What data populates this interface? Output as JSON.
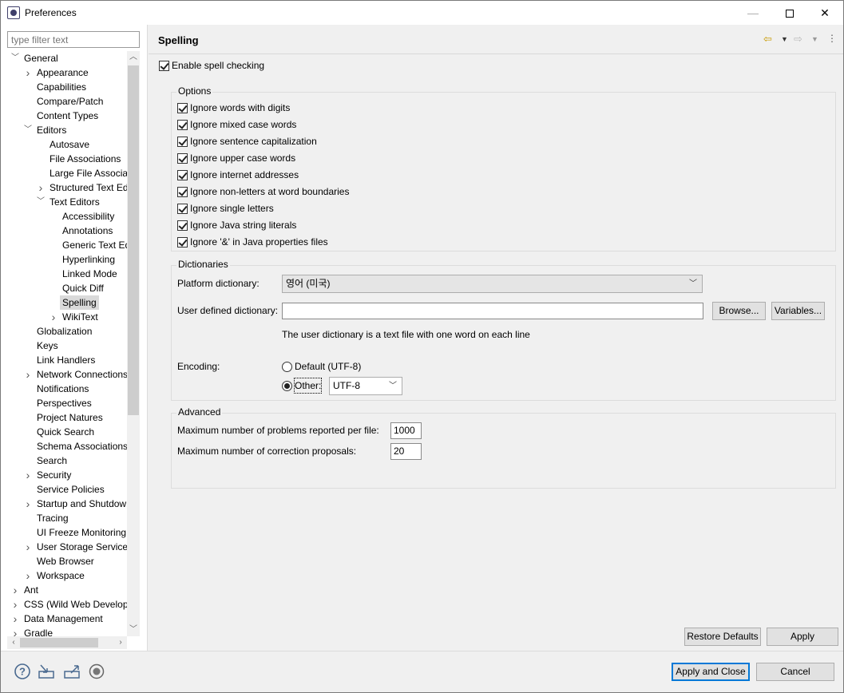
{
  "window": {
    "title": "Preferences",
    "minimize": "—",
    "close": "✕"
  },
  "filter": {
    "placeholder": "type filter text"
  },
  "tree": [
    {
      "label": "General",
      "level": 0,
      "tw": "down"
    },
    {
      "label": "Appearance",
      "level": 1,
      "tw": "right"
    },
    {
      "label": "Capabilities",
      "level": 1,
      "tw": ""
    },
    {
      "label": "Compare/Patch",
      "level": 1,
      "tw": ""
    },
    {
      "label": "Content Types",
      "level": 1,
      "tw": ""
    },
    {
      "label": "Editors",
      "level": 1,
      "tw": "down"
    },
    {
      "label": "Autosave",
      "level": 2,
      "tw": ""
    },
    {
      "label": "File Associations",
      "level": 2,
      "tw": ""
    },
    {
      "label": "Large File Associati",
      "level": 2,
      "tw": ""
    },
    {
      "label": "Structured Text Ed",
      "level": 2,
      "tw": "right"
    },
    {
      "label": "Text Editors",
      "level": 2,
      "tw": "down"
    },
    {
      "label": "Accessibility",
      "level": 3,
      "tw": ""
    },
    {
      "label": "Annotations",
      "level": 3,
      "tw": ""
    },
    {
      "label": "Generic Text Ed",
      "level": 3,
      "tw": ""
    },
    {
      "label": "Hyperlinking",
      "level": 3,
      "tw": ""
    },
    {
      "label": "Linked Mode",
      "level": 3,
      "tw": ""
    },
    {
      "label": "Quick Diff",
      "level": 3,
      "tw": ""
    },
    {
      "label": "Spelling",
      "level": 3,
      "tw": "",
      "selected": true
    },
    {
      "label": "WikiText",
      "level": 3,
      "tw": "right"
    },
    {
      "label": "Globalization",
      "level": 1,
      "tw": ""
    },
    {
      "label": "Keys",
      "level": 1,
      "tw": ""
    },
    {
      "label": "Link Handlers",
      "level": 1,
      "tw": ""
    },
    {
      "label": "Network Connections",
      "level": 1,
      "tw": "right"
    },
    {
      "label": "Notifications",
      "level": 1,
      "tw": ""
    },
    {
      "label": "Perspectives",
      "level": 1,
      "tw": ""
    },
    {
      "label": "Project Natures",
      "level": 1,
      "tw": ""
    },
    {
      "label": "Quick Search",
      "level": 1,
      "tw": ""
    },
    {
      "label": "Schema Associations",
      "level": 1,
      "tw": ""
    },
    {
      "label": "Search",
      "level": 1,
      "tw": ""
    },
    {
      "label": "Security",
      "level": 1,
      "tw": "right"
    },
    {
      "label": "Service Policies",
      "level": 1,
      "tw": ""
    },
    {
      "label": "Startup and Shutdown",
      "level": 1,
      "tw": "right"
    },
    {
      "label": "Tracing",
      "level": 1,
      "tw": ""
    },
    {
      "label": "UI Freeze Monitoring",
      "level": 1,
      "tw": ""
    },
    {
      "label": "User Storage Service",
      "level": 1,
      "tw": "right"
    },
    {
      "label": "Web Browser",
      "level": 1,
      "tw": ""
    },
    {
      "label": "Workspace",
      "level": 1,
      "tw": "right"
    },
    {
      "label": "Ant",
      "level": 0,
      "tw": "right"
    },
    {
      "label": "CSS (Wild Web Developer)",
      "level": 0,
      "tw": "right"
    },
    {
      "label": "Data Management",
      "level": 0,
      "tw": "right"
    },
    {
      "label": "Gradle",
      "level": 0,
      "tw": "right"
    }
  ],
  "page": {
    "title": "Spelling",
    "enable_spell": {
      "label": "Enable spell checking",
      "checked": true
    },
    "options_title": "Options",
    "options": [
      {
        "label": "Ignore words with digits",
        "checked": true
      },
      {
        "label": "Ignore mixed case words",
        "checked": true
      },
      {
        "label": "Ignore sentence capitalization",
        "checked": true
      },
      {
        "label": "Ignore upper case words",
        "checked": true
      },
      {
        "label": "Ignore internet addresses",
        "checked": true
      },
      {
        "label": "Ignore non-letters at word boundaries",
        "checked": true
      },
      {
        "label": "Ignore single letters",
        "checked": true
      },
      {
        "label": "Ignore Java string literals",
        "checked": true
      },
      {
        "label": "Ignore '&' in Java properties files",
        "checked": true
      }
    ],
    "dictionaries_title": "Dictionaries",
    "platform_dictionary_label": "Platform dictionary:",
    "platform_dictionary_value": "영어 (미국)",
    "user_dictionary_label": "User defined dictionary:",
    "user_dictionary_value": "",
    "browse_label": "Browse...",
    "variables_label": "Variables...",
    "user_dict_hint": "The user dictionary is a text file with one word on each line",
    "encoding_label": "Encoding:",
    "encoding_default_label": "Default (UTF-8)",
    "encoding_other_label": "Other:",
    "encoding_other_value": "UTF-8",
    "advanced_title": "Advanced",
    "max_problems_label": "Maximum number of problems reported per file:",
    "max_problems_value": "1000",
    "max_proposals_label": "Maximum number of correction proposals:",
    "max_proposals_value": "20",
    "restore_defaults_label": "Restore Defaults",
    "apply_label": "Apply"
  },
  "bottom": {
    "apply_close_label": "Apply and Close",
    "cancel_label": "Cancel",
    "icons": [
      "help-icon",
      "import-icon",
      "export-icon",
      "record-icon"
    ]
  }
}
